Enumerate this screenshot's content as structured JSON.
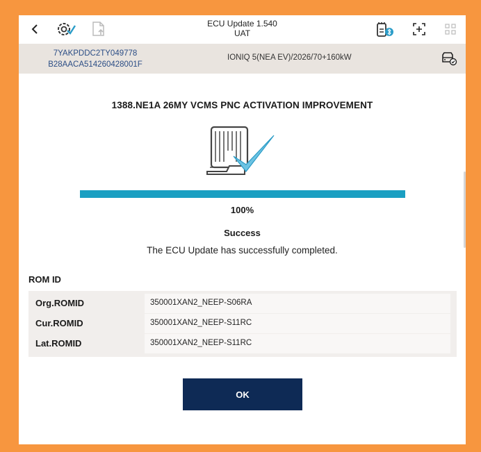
{
  "header": {
    "title": "ECU Update 1.540",
    "subtitle": "UAT",
    "icons": [
      "back-icon",
      "settings-check-icon",
      "file-upload-icon",
      "bluetooth-device-icon",
      "fullscreen-icon",
      "grid-icon"
    ]
  },
  "vehicle": {
    "vin": "7YAKPDDC2TY049778",
    "id": "B28AACA514260428001F",
    "model": "IONIQ 5(NEA EV)/2026/70+160kW"
  },
  "update": {
    "title": "1388.NE1A 26MY VCMS PNC ACTIVATION IMPROVEMENT",
    "progress_percent": 100,
    "progress_label": "100%",
    "status": "Success",
    "message": "The ECU Update has successfully completed."
  },
  "rom": {
    "heading": "ROM ID",
    "rows": [
      {
        "label": "Org.ROMID",
        "value": "350001XAN2_NEEP-S06RA"
      },
      {
        "label": "Cur.ROMID",
        "value": "350001XAN2_NEEP-S11RC"
      },
      {
        "label": "Lat.ROMID",
        "value": "350001XAN2_NEEP-S11RC"
      }
    ]
  },
  "actions": {
    "ok_label": "OK"
  },
  "colors": {
    "frame": "#f7963f",
    "progress": "#1a9fc2",
    "button": "#0e2a55",
    "vin_text": "#2b4d85",
    "check": "#4fb3d6"
  }
}
